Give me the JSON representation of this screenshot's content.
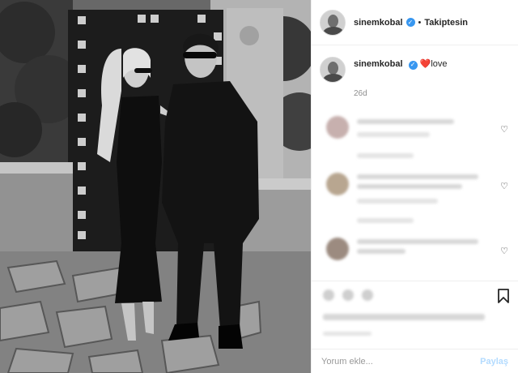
{
  "post": {
    "username": "sinemkobal",
    "follow_status": "Takiptesin",
    "dot": "•",
    "verified_glyph": "✓"
  },
  "caption": {
    "username": "sinemkobal",
    "text": "❤️love",
    "time": "26d"
  },
  "comment_input": {
    "placeholder": "Yorum ekle...",
    "post_label": "Paylaş"
  },
  "icons": {
    "heart": "♡",
    "bookmark": "bookmark-icon"
  },
  "colors": {
    "verified": "#3897f0",
    "post_button": "#b3dbff",
    "secondary_text": "#8e8e8e"
  }
}
